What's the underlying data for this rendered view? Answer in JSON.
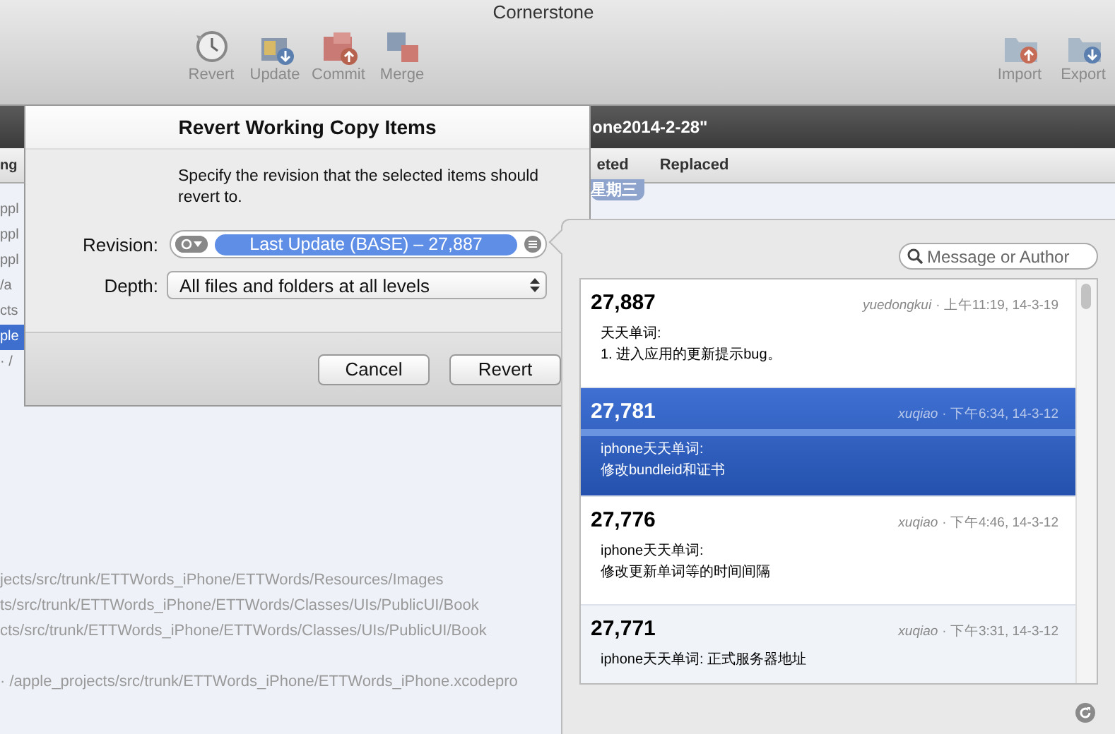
{
  "window": {
    "title": "Cornerstone"
  },
  "toolbar": {
    "left": [
      {
        "label": "Revert",
        "kind": "clock"
      },
      {
        "label": "Update",
        "kind": "update"
      },
      {
        "label": "Commit",
        "kind": "commit"
      },
      {
        "label": "Merge",
        "kind": "merge"
      }
    ],
    "right": [
      {
        "label": "Import",
        "kind": "import"
      },
      {
        "label": "Export",
        "kind": "export"
      }
    ]
  },
  "document_title": "one2014-2-28\"",
  "filter_tabs": [
    {
      "label": "ng"
    },
    {
      "label": "eted"
    },
    {
      "label": "Replaced"
    }
  ],
  "date_badge": "星期三",
  "file_list": {
    "fragments": [
      {
        "text": "ppl",
        "selected": false
      },
      {
        "text": "ppl",
        "selected": false
      },
      {
        "text": "ppl",
        "selected": false
      },
      {
        "text": "/a",
        "selected": false
      },
      {
        "text": "cts",
        "selected": false
      },
      {
        "text": "ple",
        "selected": true
      },
      {
        "text": "· /",
        "selected": false
      }
    ],
    "paths": [
      "jects/src/trunk/ETTWords_iPhone/ETTWords/Resources/Images",
      "ts/src/trunk/ETTWords_iPhone/ETTWords/Classes/UIs/PublicUI/Book",
      "cts/src/trunk/ETTWords_iPhone/ETTWords/Classes/UIs/PublicUI/Book",
      "· /apple_projects/src/trunk/ETTWords_iPhone/ETTWords_iPhone.xcodepro"
    ]
  },
  "dialog": {
    "title": "Revert Working Copy Items",
    "description": "Specify the revision that the selected items should revert to.",
    "revision_label": "Revision:",
    "revision_value": "Last Update (BASE) – 27,887",
    "depth_label": "Depth:",
    "depth_value": "All files and folders at all levels",
    "buttons": [
      {
        "label": "Cancel",
        "default": false
      },
      {
        "label": "Revert",
        "default": false
      }
    ]
  },
  "revision_popover": {
    "search": {
      "placeholder": "Message or Author"
    },
    "revisions": [
      {
        "number": "27,887",
        "author": "yuedongkui",
        "time": "· 上午11:19, 14-3-19",
        "message": "天天单词:\n1. 进入应用的更新提示bug。",
        "selected": false
      },
      {
        "number": "27,781",
        "author": "xuqiao",
        "time": "· 下午6:34, 14-3-12",
        "message": "iphone天天单词:\n修改bundleid和证书",
        "selected": true
      },
      {
        "number": "27,776",
        "author": "xuqiao",
        "time": "· 下午4:46, 14-3-12",
        "message": "iphone天天单词:\n修改更新单词等的时间间隔",
        "selected": false
      },
      {
        "number": "27,771",
        "author": "xuqiao",
        "time": "· 下午3:31, 14-3-12",
        "message": "iphone天天单词: 正式服务器地址",
        "selected": false
      }
    ]
  }
}
